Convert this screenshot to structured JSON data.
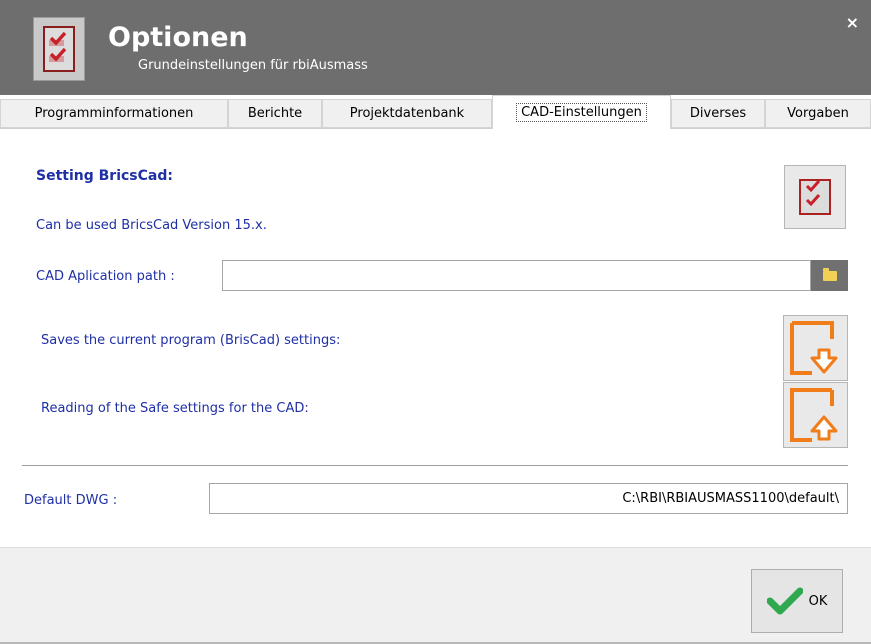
{
  "window": {
    "title": "Optionen",
    "subtitle": "Grundeinstellungen für rbiAusmass",
    "close_glyph": "×"
  },
  "tabs": [
    {
      "label": "Programminformationen"
    },
    {
      "label": "Berichte"
    },
    {
      "label": "Projektdatenbank"
    },
    {
      "label": "CAD-Einstellungen",
      "active": true
    },
    {
      "label": "Diverses"
    },
    {
      "label": "Vorgaben"
    }
  ],
  "cad": {
    "heading": "Setting BricsCad:",
    "version_text": "Can be used BricsCad Version 15.x.",
    "path_label": "CAD Aplication path :",
    "path_value": "",
    "save_text": "Saves the current program (BrisCad) settings:",
    "read_text": "Reading of the Safe settings for the CAD:",
    "default_dwg_label": "Default DWG :",
    "default_dwg_value": "C:\\RBI\\RBIAUSMASS1100\\default\\"
  },
  "footer": {
    "ok_label": "OK"
  },
  "icons": {
    "app": "checklist-icon",
    "browse": "folder-icon",
    "save": "save-download-icon",
    "read": "read-upload-icon",
    "ok": "checkmark-icon"
  },
  "colors": {
    "titlebar": "#6e6e6e",
    "label_blue": "#1f2fa6",
    "accent_orange": "#f07d1a",
    "ok_green": "#2fa84f",
    "check_red": "#c8202a"
  }
}
